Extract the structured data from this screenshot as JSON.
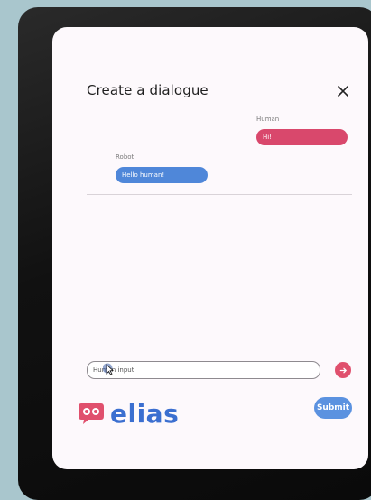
{
  "dialog": {
    "title": "Create a dialogue"
  },
  "messages": [
    {
      "speaker": "Human",
      "text": "Hi!",
      "color": "#d9486c"
    },
    {
      "speaker": "Robot",
      "text": "Hello human!",
      "color": "#4f87d9"
    }
  ],
  "input": {
    "placeholder": "Human input",
    "value": ""
  },
  "buttons": {
    "submit_label": "Submit",
    "send_icon": "arrow-right-icon",
    "close_icon": "close-icon"
  },
  "brand": {
    "name": "elias",
    "logo_icon": "chat-bubble-robot-icon",
    "primary_color": "#3b6fd0",
    "accent_color": "#e0506d"
  }
}
